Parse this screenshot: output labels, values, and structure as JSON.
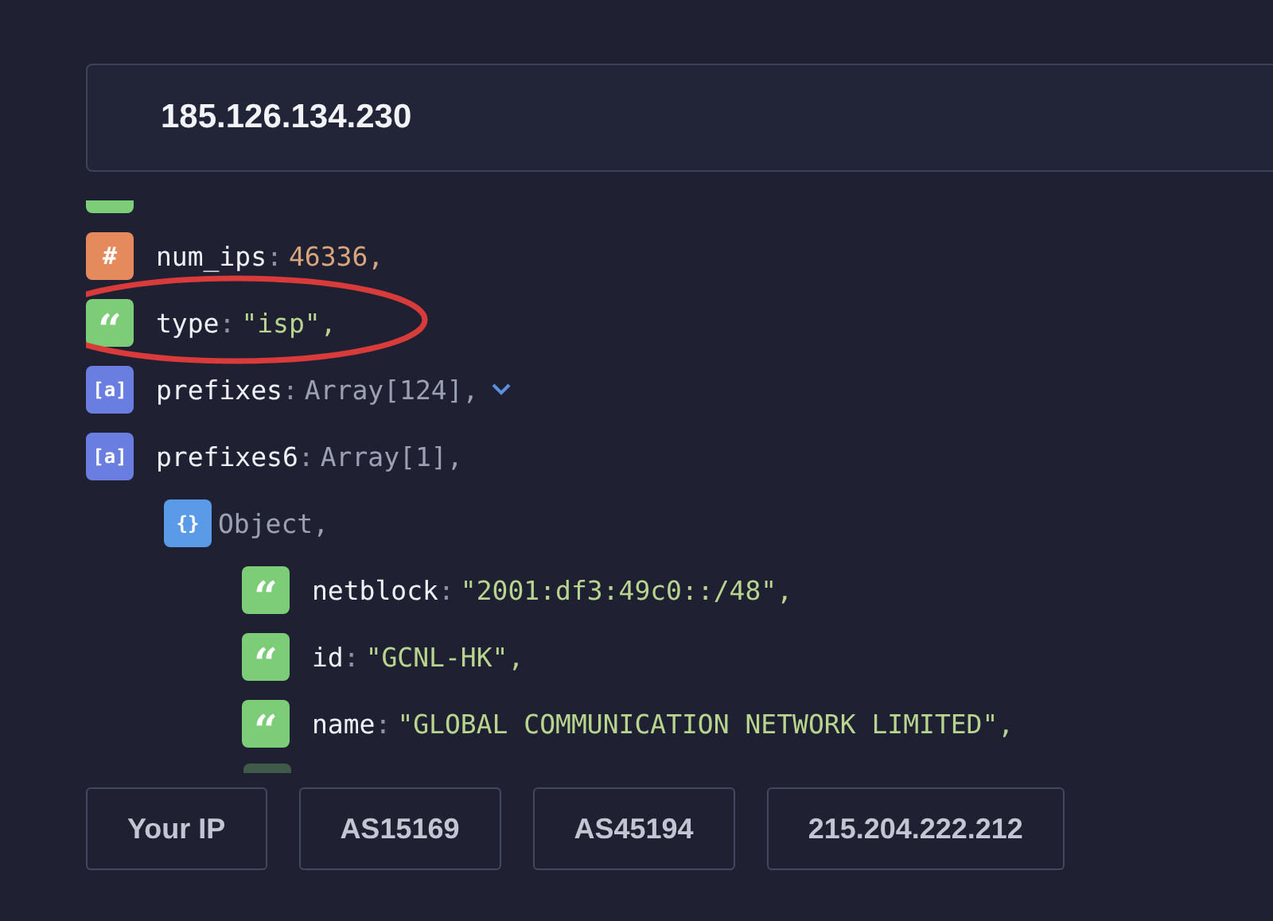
{
  "search": {
    "value": "185.126.134.230"
  },
  "tree": [
    {
      "kind": "number",
      "icon": "#",
      "key": "num_ips",
      "colon": ":",
      "value": "46336,",
      "toggle": false,
      "circled": false
    },
    {
      "kind": "string",
      "icon": "“",
      "key": "type",
      "colon": ":",
      "value": "\"isp\",",
      "toggle": false,
      "circled": true
    },
    {
      "kind": "array",
      "icon": "[a]",
      "key": "prefixes",
      "colon": ":",
      "value": "Array[124],",
      "toggle": true,
      "circled": false
    },
    {
      "kind": "array",
      "icon": "[a]",
      "key": "prefixes6",
      "colon": ":",
      "value": "Array[1],",
      "toggle": false,
      "circled": false,
      "children": [
        {
          "kind": "object",
          "icon": "{}",
          "value": "Object,",
          "toggle": false,
          "circled": false,
          "children": [
            {
              "kind": "string",
              "icon": "“",
              "key": "netblock",
              "colon": ":",
              "value": "\"2001:df3:49c0::/48\",",
              "toggle": false,
              "circled": false
            },
            {
              "kind": "string",
              "icon": "“",
              "key": "id",
              "colon": ":",
              "value": "\"GCNL-HK\",",
              "toggle": false,
              "circled": false
            },
            {
              "kind": "string",
              "icon": "“",
              "key": "name",
              "colon": ":",
              "value": "\"GLOBAL COMMUNICATION NETWORK LIMITED\",",
              "toggle": false,
              "circled": false
            }
          ]
        }
      ]
    }
  ],
  "buttons": [
    "Your IP",
    "AS15169",
    "AS45194",
    "215.204.222.212"
  ]
}
